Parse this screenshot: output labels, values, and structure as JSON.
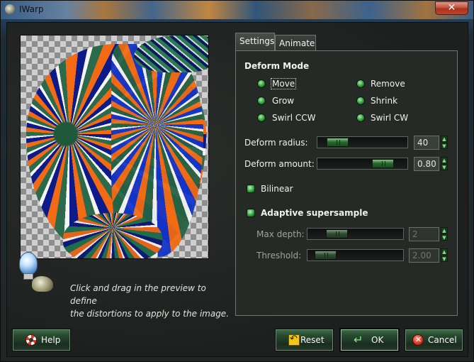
{
  "window": {
    "title": "IWarp",
    "close_glyph": "✕"
  },
  "tabs": [
    {
      "label": "Settings",
      "active": true
    },
    {
      "label": "Animate",
      "active": false
    }
  ],
  "deform_mode": {
    "heading": "Deform Mode",
    "options": [
      {
        "label": "Move",
        "selected": true
      },
      {
        "label": "Remove",
        "selected": false
      },
      {
        "label": "Grow",
        "selected": false
      },
      {
        "label": "Shrink",
        "selected": false
      },
      {
        "label": "Swirl CCW",
        "selected": false
      },
      {
        "label": "Swirl CW",
        "selected": false
      }
    ]
  },
  "deform_radius": {
    "label": "Deform radius:",
    "value": "40",
    "fraction": 0.1
  },
  "deform_amount": {
    "label": "Deform amount:",
    "value": "0.80",
    "fraction": 0.65
  },
  "bilinear": {
    "label": "Bilinear",
    "checked": true
  },
  "adaptive": {
    "label": "Adaptive supersample",
    "checked": true
  },
  "max_depth": {
    "label": "Max depth:",
    "value": "2",
    "fraction": 0.2
  },
  "threshold": {
    "label": "Threshold:",
    "value": "2.00",
    "fraction": 0.1
  },
  "hint": {
    "line1": "Click and drag in the preview to define",
    "line2": "the distortions to apply to the image."
  },
  "buttons": {
    "help": "Help",
    "reset": "Reset",
    "ok": "OK",
    "cancel": "Cancel"
  },
  "icons": {
    "window": "gimp-wilber-icon",
    "hint": "lightbulb-wilber-icon",
    "help": "lifebuoy-icon",
    "reset": "reset-arrow-icon",
    "ok": "enter-arrow-icon",
    "cancel": "cancel-icon"
  },
  "colors": {
    "accent": "#2d9a3a",
    "window_bg": "#202321",
    "close": "#c9442b"
  }
}
